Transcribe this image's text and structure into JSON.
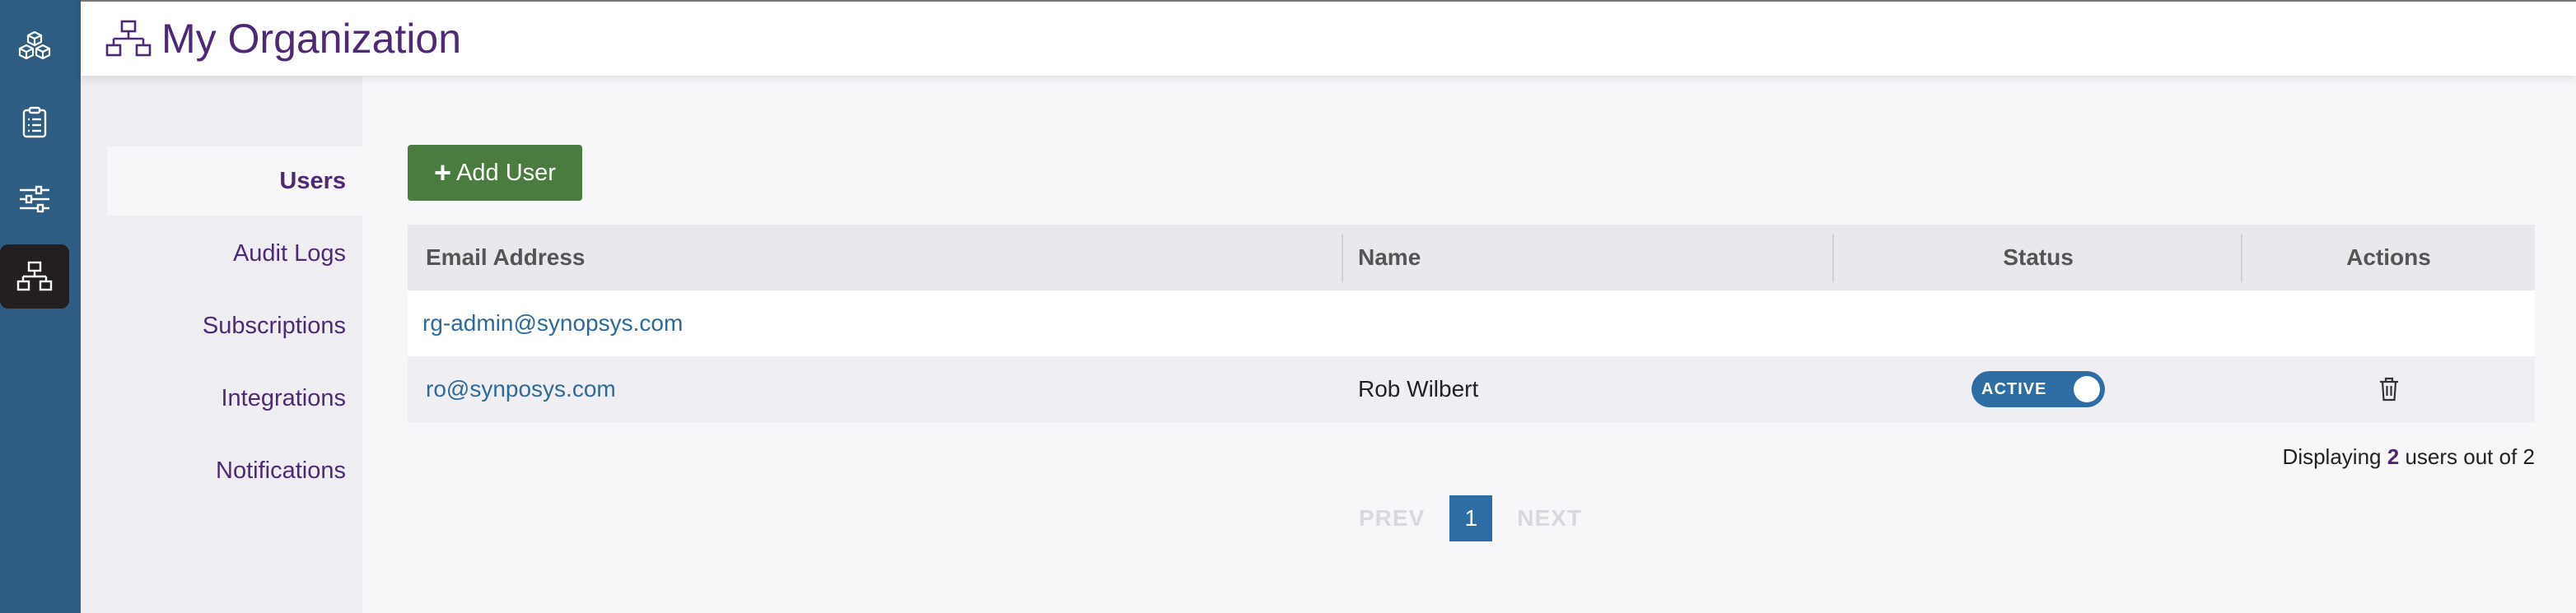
{
  "header": {
    "title": "My Organization"
  },
  "rail": {
    "items": [
      {
        "name": "products"
      },
      {
        "name": "reports"
      },
      {
        "name": "settings"
      },
      {
        "name": "organization"
      }
    ]
  },
  "subnav": {
    "items": [
      {
        "label": "Users"
      },
      {
        "label": "Audit Logs"
      },
      {
        "label": "Subscriptions"
      },
      {
        "label": "Integrations"
      },
      {
        "label": "Notifications"
      }
    ],
    "active_index": 0
  },
  "toolbar": {
    "add_user_label": "Add User"
  },
  "table": {
    "columns": [
      "Email Address",
      "Name",
      "Status",
      "Actions"
    ],
    "rows": [
      {
        "email": "rg-admin@synopsys.com",
        "name": "",
        "status": ""
      },
      {
        "email": "ro@synposys.com",
        "name": "Rob Wilbert",
        "status": "ACTIVE"
      }
    ]
  },
  "summary": {
    "prefix": "Displaying",
    "shown": "2",
    "middle": "users out of",
    "total": "2"
  },
  "pagination": {
    "prev": "PREV",
    "current": "1",
    "next": "NEXT"
  },
  "colors": {
    "rail": "#2e5c82",
    "accent_purple": "#4e2a74",
    "button_green": "#4a7c3f",
    "link_blue": "#2e6a99",
    "toggle_blue": "#2e6da4"
  }
}
